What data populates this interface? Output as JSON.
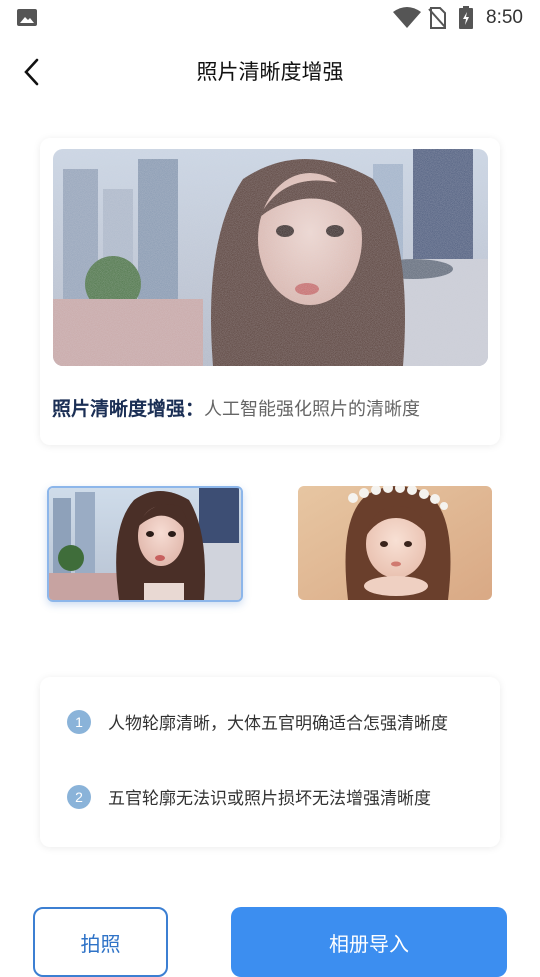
{
  "status_bar": {
    "time": "8:50",
    "icons": [
      "gallery-icon",
      "wifi-icon",
      "no-sim-icon",
      "battery-charging-icon"
    ]
  },
  "header": {
    "title": "照片清晰度增强",
    "back_icon": "chevron-left-icon"
  },
  "hero": {
    "caption_label": "照片清晰度增强：",
    "caption_desc": "人工智能强化照片的清晰度"
  },
  "samples": {
    "items": [
      "sample-city-portrait",
      "sample-flower-crown-portrait"
    ],
    "selected_index": 0
  },
  "tips": [
    {
      "number": "1",
      "text": "人物轮廓清晰，大体五官明确适合怎强清晰度"
    },
    {
      "number": "2",
      "text": "五官轮廓无法识或照片损坏无法增强清晰度"
    }
  ],
  "actions": {
    "photo_label": "拍照",
    "album_label": "相册导入"
  },
  "colors": {
    "primary": "#3c8ef0",
    "caption_label": "#1b2f55",
    "tip_badge": "#8ab3d9"
  }
}
